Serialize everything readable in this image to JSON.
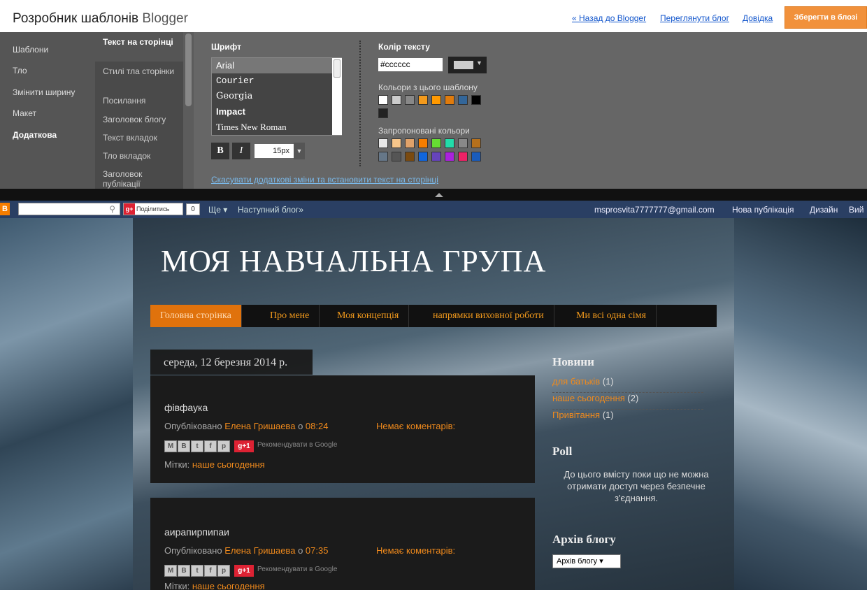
{
  "top": {
    "title_main": "Розробник шаблонів",
    "title_sub": "Blogger",
    "links": [
      "« Назад до Blogger",
      "Переглянути блог",
      "Довідка"
    ],
    "save_label": "Зберегти в блозі"
  },
  "designer": {
    "nav1": [
      "Шаблони",
      "Тло",
      "Змінити ширину",
      "Макет",
      "Додаткова"
    ],
    "nav2_active": "Текст на сторінці",
    "nav2": [
      "Стилі тла сторінки",
      "Посилання",
      "Заголовок блогу",
      "Текст вкладок",
      "Тло вкладок",
      "Заголовок публікації"
    ],
    "font_heading": "Шрифт",
    "fonts": [
      "Arial",
      "Courier",
      "Georgia",
      "Impact",
      "Times New Roman"
    ],
    "bold_label": "B",
    "italic_label": "I",
    "font_size": "15px",
    "text_color_heading": "Колір тексту",
    "hex_value": "#cccccc",
    "template_colors_label": "Кольори з цього шаблону",
    "template_colors": [
      "#ffffff",
      "#cccccc",
      "#888888",
      "#f39a1c",
      "#ff9900",
      "#e07b0c",
      "#336699",
      "#000000",
      "#222222"
    ],
    "suggested_colors_label": "Запропоновані кольори",
    "suggested_colors": [
      "#e8e8e8",
      "#f6c58a",
      "#e0a26a",
      "#f57d00",
      "#66dd33",
      "#22ddaa",
      "#888888",
      "#b5701c",
      "#667788",
      "#555555",
      "#7a4a10",
      "#1166dd",
      "#6644bb",
      "#aa22dd",
      "#ee2266",
      "#1a5cbb"
    ],
    "cancel_link": "Скасувати додаткові зміни та встановити текст на сторінці"
  },
  "navbar": {
    "logo": "B",
    "share_label": "Поділитись",
    "share_count": "0",
    "more": "Ще ▾",
    "next_blog": "Наступний блог»",
    "email": "msprosvita7777777@gmail.com",
    "new_post": "Нова публікація",
    "design": "Дизайн",
    "exit": "Вий"
  },
  "blog": {
    "title": "МОЯ НАВЧАЛЬНА ГРУПА",
    "tabs": [
      "Головна сторінка",
      "Про мене",
      "Моя концепція",
      "напрямки виховної роботи",
      "Ми всі одна сімя"
    ],
    "date": "середа, 12 березня 2014 р.",
    "posts": [
      {
        "title": "фівфаука",
        "published_prefix": "Опубліковано",
        "author": "Елена Гришаева",
        "at": "о",
        "time": "08:24",
        "comments": "Немає коментарів:",
        "recommend": "Рекомендувати в Google",
        "tags_label": "Мітки:",
        "tag": "наше сьогодення"
      },
      {
        "title": "аирапирпипаи",
        "published_prefix": "Опубліковано",
        "author": "Елена Гришаева",
        "at": "о",
        "time": "07:35",
        "comments": "Немає коментарів:",
        "recommend": "Рекомендувати в Google",
        "tags_label": "Мітки:",
        "tag": "наше сьогодення"
      }
    ],
    "sidebar": {
      "news_heading": "Новини",
      "news": [
        {
          "label": "для батьків",
          "count": "(1)"
        },
        {
          "label": "наше сьогодення",
          "count": "(2)"
        },
        {
          "label": "Привітання",
          "count": "(1)"
        }
      ],
      "poll_heading": "Poll",
      "poll_text": "До цього вмісту поки що не можна отримати доступ через безпечне з'єднання.",
      "archive_heading": "Архів блогу",
      "archive_select": "Архів блогу ▾"
    }
  }
}
